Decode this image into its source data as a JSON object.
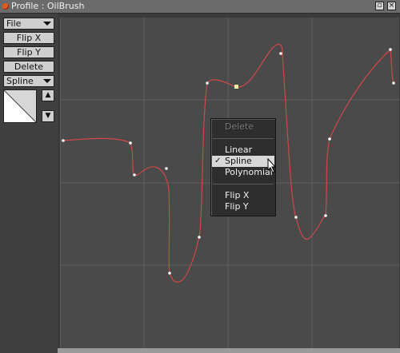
{
  "window": {
    "title": "Profile : OilBrush"
  },
  "panel": {
    "file_label": "File",
    "flip_x_label": "Flip X",
    "flip_y_label": "Flip Y",
    "delete_label": "Delete",
    "mode_label": "Spline",
    "up_icon": "up-arrow-icon",
    "down_icon": "down-arrow-icon"
  },
  "context_menu": {
    "delete": "Delete",
    "linear": "Linear",
    "spline": "Spline",
    "polynomial": "Polynomial",
    "flip_x": "Flip X",
    "flip_y": "Flip Y",
    "selected": "Spline"
  },
  "colors": {
    "curve": "#d04848",
    "grid": "#5e5e5e",
    "selected_point": "#f5f0a0"
  }
}
